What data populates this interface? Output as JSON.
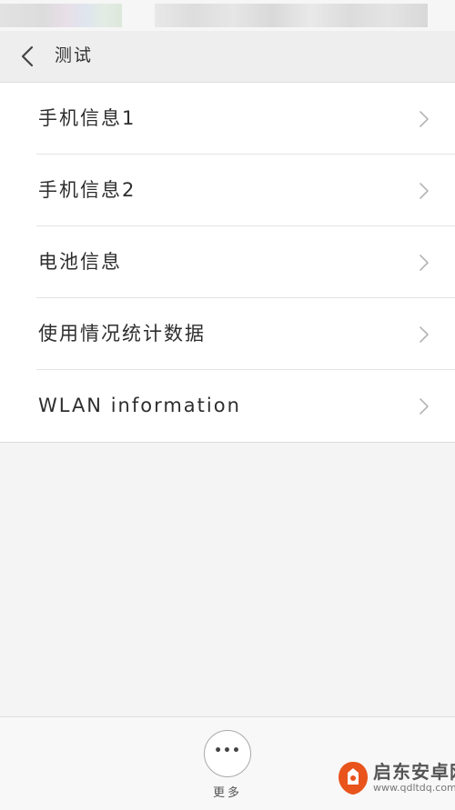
{
  "header": {
    "title": "测试",
    "back_icon": "chevron-left-icon"
  },
  "list": {
    "items": [
      {
        "label": "手机信息1"
      },
      {
        "label": "手机信息2"
      },
      {
        "label": "电池信息"
      },
      {
        "label": "使用情况统计数据"
      },
      {
        "label": "WLAN information"
      }
    ],
    "item_icon": "chevron-right-icon"
  },
  "bottom_bar": {
    "more_icon": "ellipsis-icon",
    "more_label": "更多"
  },
  "watermark": {
    "name": "启东安卓网",
    "url": "www.qdltdq.com"
  },
  "colors": {
    "header_bg": "#eeeeee",
    "list_bg": "#ffffff",
    "page_bg": "#f4f4f4",
    "watermark_accent": "#e8541b"
  }
}
